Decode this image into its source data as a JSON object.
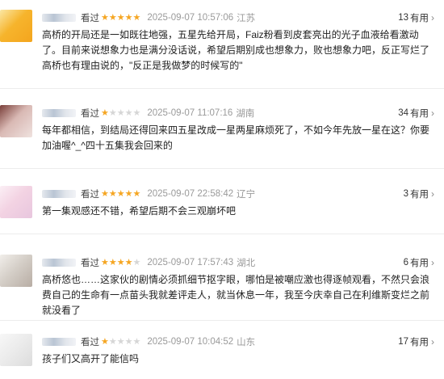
{
  "colors": {
    "star_on": "#f5a623",
    "star_off": "#d6d6d6",
    "time": "#9a9a9a"
  },
  "reviews": [
    {
      "avatar_colors": [
        "#f6b42c",
        "#fbe7a4",
        "#f4a51e"
      ],
      "seen_label": "看过",
      "rating": 5,
      "time": "2025-09-07 10:57:06",
      "location": "江苏",
      "useful_count": "13",
      "useful_label": "有用",
      "content": "高桥的开局还是一如既往地强，五星先给开局，Faiz粉看到皮套亮出的光子血液给看激动了。目前来说想象力也是满分没话说，希望后期别成也想象力，败也想象力吧，反正写烂了高桥也有理由说的，\"反正是我做梦的时候写的\""
    },
    {
      "avatar_colors": [
        "#d9b9b4",
        "#7a3f3a",
        "#efe2df"
      ],
      "seen_label": "看过",
      "rating": 1,
      "time": "2025-09-07 11:07:16",
      "location": "湖南",
      "useful_count": "34",
      "useful_label": "有用",
      "content": "每年都相信，到结局还得回来四五星改成一星两星麻烦死了，不如今年先放一星在这？你要加油喔^_^四十五集我会回来的"
    },
    {
      "avatar_colors": [
        "#f3d3e3",
        "#fbeff5",
        "#e8c6de"
      ],
      "seen_label": "看过",
      "rating": 5,
      "time": "2025-09-07 22:58:42",
      "location": "辽宁",
      "useful_count": "3",
      "useful_label": "有用",
      "content": "第一集观感还不错，希望后期不会三观崩坏吧"
    },
    {
      "avatar_colors": [
        "#d5cfc8",
        "#f1eeea",
        "#b8ada4"
      ],
      "seen_label": "看过",
      "rating": 4,
      "time": "2025-09-07 17:57:43",
      "location": "湖北",
      "useful_count": "6",
      "useful_label": "有用",
      "content": "高桥悠也……这家伙的剧情必须抓细节抠字眼，哪怕是被嘲应激也得逐帧观看，不然只会浪费自己的生命有一点苗头我就差评走人，就当休息一年，我至今庆幸自己在利维斯变烂之前就没看了"
    },
    {
      "avatar_colors": [
        "#ececec",
        "#f7f7f7",
        "#dcdcdc"
      ],
      "seen_label": "看过",
      "rating": 1,
      "time": "2025-09-07 10:04:52",
      "location": "山东",
      "useful_count": "17",
      "useful_label": "有用",
      "content": "孩子们又高开了能信吗"
    }
  ]
}
